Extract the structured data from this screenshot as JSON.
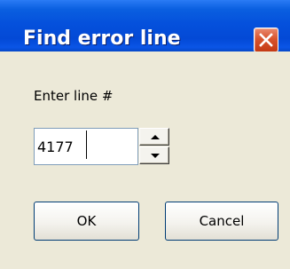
{
  "dialog": {
    "title": "Find error line",
    "close_icon": "close-icon"
  },
  "form": {
    "label": "Enter line #",
    "line_value": "4177",
    "spin_up_icon": "arrow-up-icon",
    "spin_down_icon": "arrow-down-icon"
  },
  "buttons": {
    "ok": "OK",
    "cancel": "Cancel"
  },
  "colors": {
    "title_bar": "#0551dc",
    "close_button": "#d8542e",
    "dialog_background": "#ece9d8",
    "button_border": "#003c74"
  }
}
